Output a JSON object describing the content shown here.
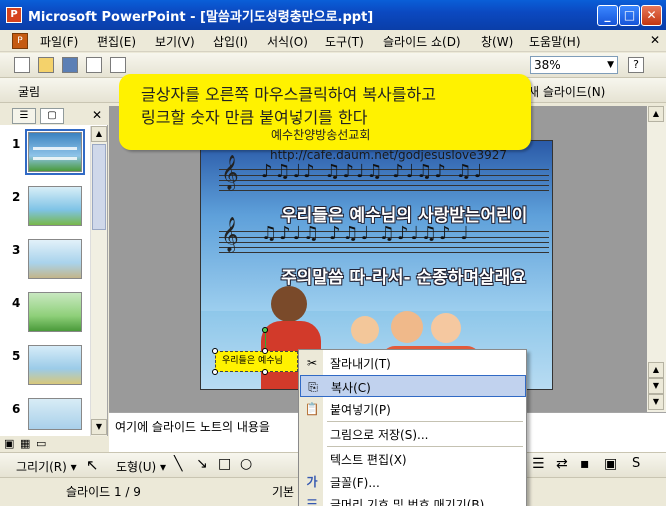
{
  "window": {
    "title": "Microsoft PowerPoint - [말씀과기도성령충만으로.ppt]",
    "minimize": "_",
    "maximize": "□",
    "close": "✕"
  },
  "menu": {
    "items": [
      "파일(F)",
      "편집(E)",
      "보기(V)",
      "삽입(I)",
      "서식(O)",
      "도구(T)",
      "슬라이드 쇼(D)",
      "창(W)",
      "도움말(H)"
    ],
    "close_x": "✕"
  },
  "toolbar": {
    "zoom": "38%",
    "font": "굴림",
    "new_slide": "새 슬라이드(N)",
    "help_icon": "?"
  },
  "callout": {
    "line1": "글상자를 오른쪽 마우스클릭하여 복사를하고",
    "line2": "링크할 숫자 만큼 붙여넣기를 한다",
    "line3": "예수찬양방송선교회"
  },
  "slide": {
    "url": "http://cafe.daum.net/godjesuslove3927",
    "lyric1": "우리들은 예수님의  사랑받는어린이",
    "lyric2": "주의말씀  따-라서-  순종하며살래요",
    "selected_textbox": "우리들은 예수님"
  },
  "thumbnails": {
    "numbers": [
      "1",
      "2",
      "3",
      "4",
      "5",
      "6"
    ],
    "selected": "1"
  },
  "context_menu": {
    "items": [
      {
        "label": "잘라내기(T)",
        "icon": "scissors-icon",
        "glyph": "✂"
      },
      {
        "label": "복사(C)",
        "icon": "copy-icon",
        "glyph": "⎘",
        "highlighted": true
      },
      {
        "label": "붙여넣기(P)",
        "icon": "paste-icon",
        "glyph": "📋"
      },
      {
        "label": "그림으로 저장(S)...",
        "icon": "",
        "glyph": ""
      },
      {
        "label": "텍스트 편집(X)",
        "icon": "",
        "glyph": ""
      },
      {
        "label": "글꼴(F)...",
        "icon": "font-icon",
        "glyph": "가"
      },
      {
        "label": "글머리 기호 및 번호 매기기(B)...",
        "icon": "bullets-icon",
        "glyph": "☰"
      }
    ]
  },
  "notes": {
    "text": "여기에 슬라이드 노트의 내용을"
  },
  "drawing": {
    "draw": "그리기(R) ▾",
    "autoshapes": "도형(U) ▾"
  },
  "status": {
    "slide": "슬라이드 1 / 9",
    "design": "기본"
  },
  "colors": {
    "titlebar": "#0b49c1",
    "callout": "#fff200",
    "menu_highlight": "#c1d2ee"
  }
}
